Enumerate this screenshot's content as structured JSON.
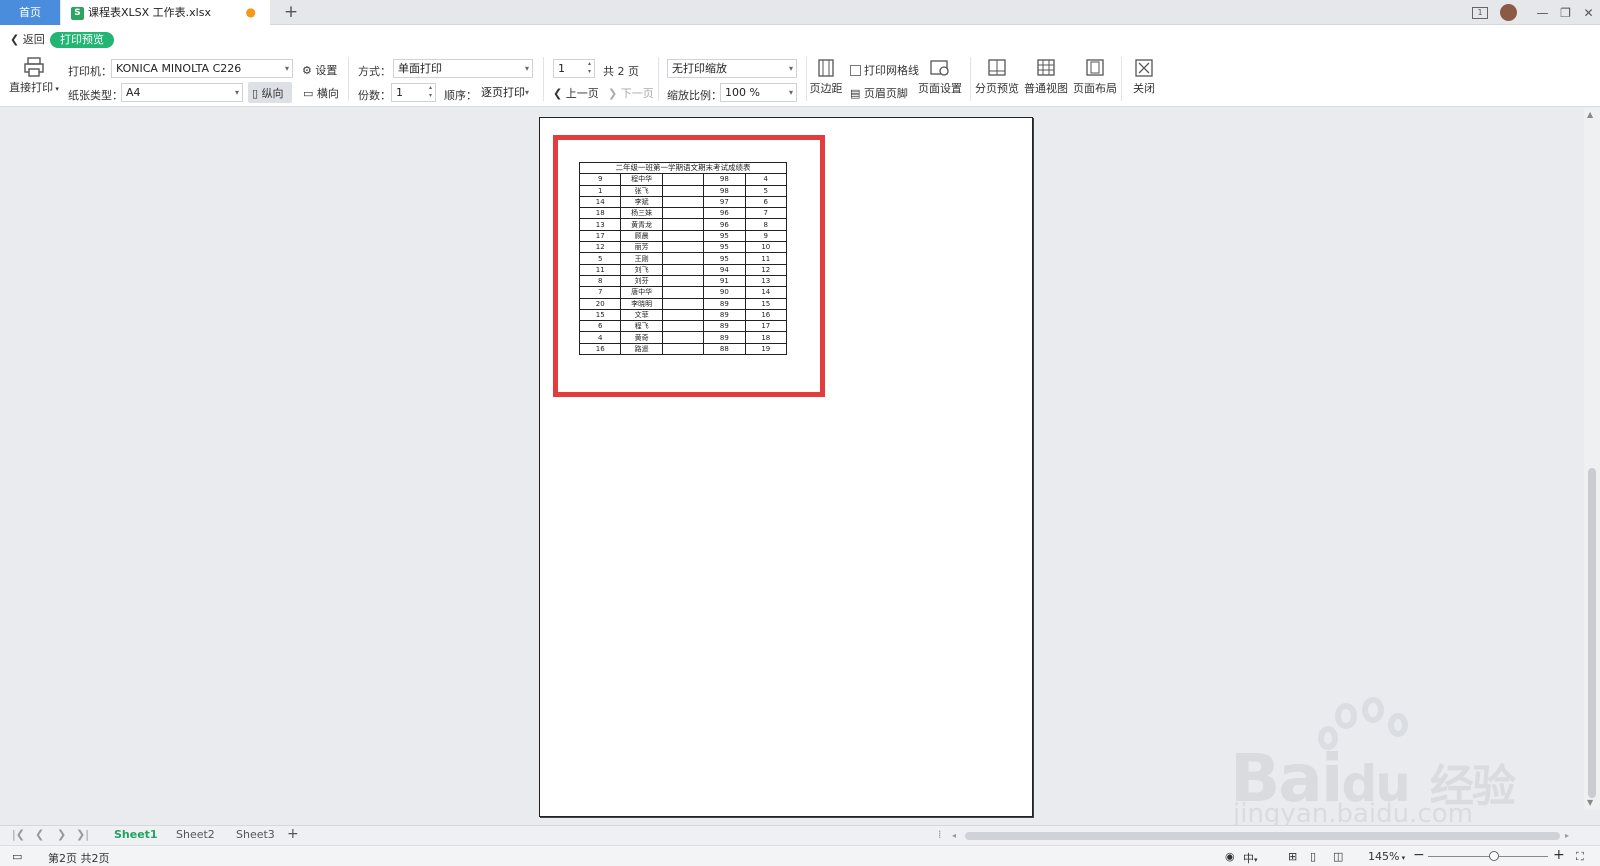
{
  "titlebar": {
    "home_tab": "首页",
    "file_tab": "课程表XLSX 工作表.xlsx",
    "file_icon": "S"
  },
  "backrow": {
    "back_label": "返回",
    "preview_label": "打印预览"
  },
  "toolbar": {
    "direct_print": "直接打印",
    "printer_label": "打印机：",
    "printer_value": "KONICA MINOLTA C226",
    "settings_label": "设置",
    "paper_label": "纸张类型：",
    "paper_value": "A4",
    "portrait_label": "纵向",
    "landscape_label": "横向",
    "mode_label": "方式：",
    "mode_value": "单面打印",
    "copies_label": "份数：",
    "copies_value": "1",
    "order_label": "顺序：",
    "order_value": "逐页打印",
    "page_input": "1",
    "total_pages": "共 2 页",
    "prev_page": "上一页",
    "next_page": "下一页",
    "scale_mode": "无打印缩放",
    "scale_label": "缩放比例：",
    "scale_value": "100 %",
    "margins": "页边距",
    "print_grid": "打印网格线",
    "header_footer": "页眉页脚",
    "page_setup": "页面设置",
    "page_break_preview": "分页预览",
    "normal_view": "普通视图",
    "page_layout": "页面布局",
    "close": "关闭"
  },
  "sheet_table": {
    "title": "二年级一班第一学期语文期末考试成绩表",
    "rows": [
      [
        "9",
        "程中华",
        "",
        "98",
        "4"
      ],
      [
        "1",
        "张飞",
        "",
        "98",
        "5"
      ],
      [
        "14",
        "李斌",
        "",
        "97",
        "6"
      ],
      [
        "18",
        "杨三妹",
        "",
        "96",
        "7"
      ],
      [
        "13",
        "黄青龙",
        "",
        "96",
        "8"
      ],
      [
        "17",
        "顾晨",
        "",
        "95",
        "9"
      ],
      [
        "12",
        "丽芳",
        "",
        "95",
        "10"
      ],
      [
        "5",
        "王刚",
        "",
        "95",
        "11"
      ],
      [
        "11",
        "刘飞",
        "",
        "94",
        "12"
      ],
      [
        "8",
        "刘芬",
        "",
        "91",
        "13"
      ],
      [
        "7",
        "唐中华",
        "",
        "90",
        "14"
      ],
      [
        "20",
        "李晓明",
        "",
        "89",
        "15"
      ],
      [
        "15",
        "文菲",
        "",
        "89",
        "16"
      ],
      [
        "6",
        "程飞",
        "",
        "89",
        "17"
      ],
      [
        "4",
        "黄奇",
        "",
        "89",
        "18"
      ],
      [
        "16",
        "路遥",
        "",
        "88",
        "19"
      ]
    ]
  },
  "sheet_tabs": [
    "Sheet1",
    "Sheet2",
    "Sheet3"
  ],
  "status": {
    "page_info": "第2页 共2页",
    "input_mode": "中",
    "zoom": "145%"
  },
  "watermark": {
    "brand": "Bai",
    "brand2": "du",
    "brand3": "经验",
    "url": "jingyan.baidu.com"
  },
  "colors": {
    "accent_green": "#22b573",
    "highlight_red": "#e43c3c",
    "home_tab_blue": "#4a8ddc"
  }
}
